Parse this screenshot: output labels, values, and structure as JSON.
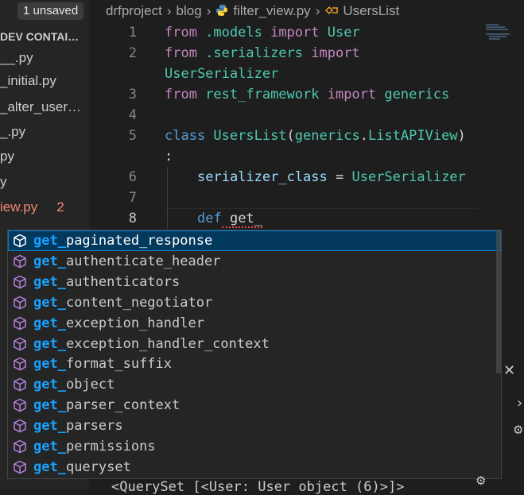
{
  "sidebar": {
    "unsaved_badge": "1 unsaved",
    "section_header": "DEV CONTAI…",
    "files": [
      {
        "label": "__.py",
        "error": false,
        "count": ""
      },
      {
        "label": "_initial.py",
        "error": false,
        "count": ""
      },
      {
        "label": "_alter_user…",
        "error": false,
        "count": ""
      },
      {
        "label": "_.py",
        "error": false,
        "count": ""
      },
      {
        "label": "py",
        "error": false,
        "count": ""
      },
      {
        "label": "y",
        "error": false,
        "count": ""
      },
      {
        "label": "iew.py",
        "error": true,
        "count": "2"
      }
    ]
  },
  "breadcrumb": {
    "project": "drfproject",
    "folder": "blog",
    "file": "filter_view.py",
    "symbol": "UsersList",
    "separator": "›"
  },
  "editor": {
    "line_numbers": [
      "1",
      "2",
      "",
      "3",
      "4",
      "5",
      "",
      "6",
      "7",
      "8"
    ],
    "lines": {
      "l1": {
        "from": "from",
        "module": " .models",
        "import": " import",
        "name": " User"
      },
      "l2": {
        "from": "from",
        "module": " .serializers",
        "import": " import"
      },
      "l2b": {
        "name": "UserSerializer"
      },
      "l3": {
        "from": "from",
        "module": " rest_framework",
        "import": " import",
        "name": " generics"
      },
      "l5": {
        "class": "class",
        "name": " UsersList",
        "paren": "(",
        "base_mod": "generics",
        "dot": ".",
        "base": "ListAPIView",
        "close": ")"
      },
      "l5b": {
        "colon": ":"
      },
      "l6": {
        "var": "serializer_class",
        "eq": " = ",
        "value": "UserSerializer"
      },
      "l8": {
        "def": "def",
        "typed": " get_"
      }
    }
  },
  "suggestions": {
    "prefix": "get_",
    "items": [
      {
        "rest": "paginated_response",
        "selected": true
      },
      {
        "rest": "authenticate_header",
        "selected": false
      },
      {
        "rest": "authenticators",
        "selected": false
      },
      {
        "rest": "content_negotiator",
        "selected": false
      },
      {
        "rest": "exception_handler",
        "selected": false
      },
      {
        "rest": "exception_handler_context",
        "selected": false
      },
      {
        "rest": "format_suffix",
        "selected": false
      },
      {
        "rest": "object",
        "selected": false
      },
      {
        "rest": "parser_context",
        "selected": false
      },
      {
        "rest": "parsers",
        "selected": false
      },
      {
        "rest": "permissions",
        "selected": false
      },
      {
        "rest": "queryset",
        "selected": false
      }
    ]
  },
  "panel": {
    "output_text": "<QuerySet [<User: User object (6)>]>"
  },
  "icons": {
    "close": "close-icon",
    "python_file": "python-file-icon",
    "symbol": "symbol-class-icon",
    "method": "method-cube-icon",
    "debug": "debug-icon"
  },
  "colors": {
    "background": "#1e1e1e",
    "keyword": "#c586c0",
    "class": "#4ec9b0",
    "variable": "#9cdcfe",
    "match_highlight": "#18a3ff",
    "selection": "#04395e",
    "error": "#f48771"
  }
}
